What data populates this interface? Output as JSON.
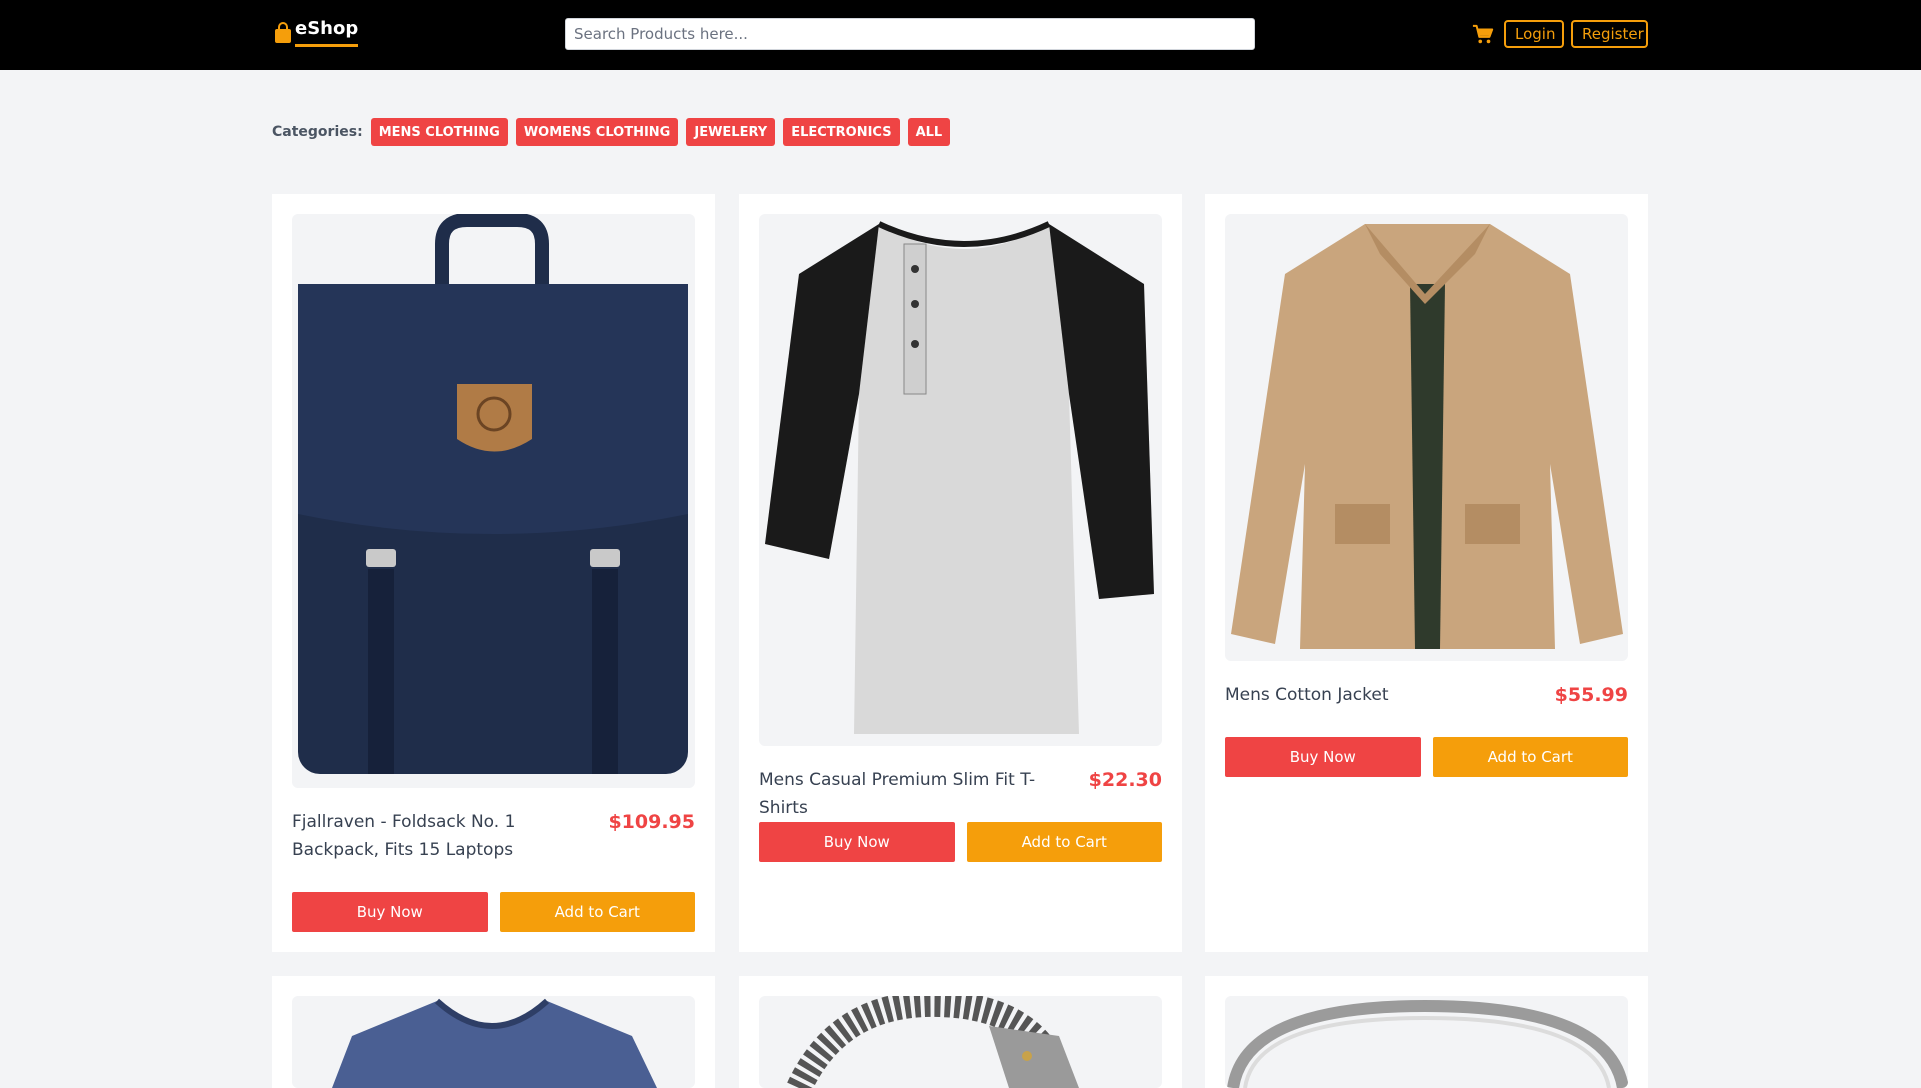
{
  "brand": {
    "name": "eShop",
    "icon": "shopping-bag-icon"
  },
  "search": {
    "placeholder": "Search Products here..."
  },
  "nav": {
    "cart_icon": "cart-icon",
    "login_label": "Login",
    "register_label": "Register"
  },
  "categories": {
    "label": "Categories:",
    "items": [
      "MENS CLOTHING",
      "WOMENS CLOTHING",
      "JEWELERY",
      "ELECTRONICS",
      "ALL"
    ]
  },
  "products": [
    {
      "title": "Fjallraven - Foldsack No. 1 Backpack, Fits 15 Laptops",
      "price": "$109.95",
      "buy_label": "Buy Now",
      "cart_label": "Add to Cart"
    },
    {
      "title": "Mens Casual Premium Slim Fit T-Shirts",
      "price": "$22.30",
      "buy_label": "Buy Now",
      "cart_label": "Add to Cart"
    },
    {
      "title": "Mens Cotton Jacket",
      "price": "$55.99",
      "buy_label": "Buy Now",
      "cart_label": "Add to Cart"
    }
  ],
  "colors": {
    "accent": "#f59e0b",
    "primary": "#ef4444",
    "header_bg": "#000000",
    "page_bg": "#f3f4f6"
  }
}
